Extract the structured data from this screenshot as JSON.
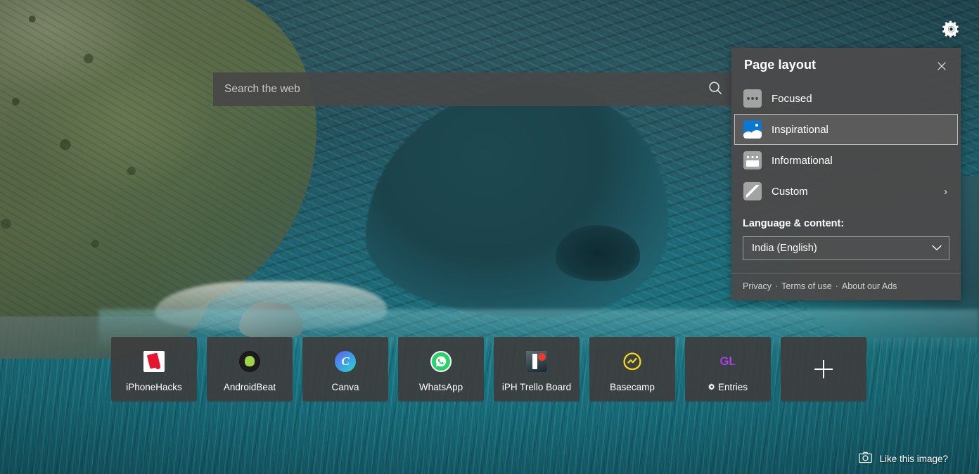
{
  "page": {
    "background_description": "Marble Caves turquoise rock formation over teal water",
    "settings_icon": "gear-icon"
  },
  "search": {
    "placeholder": "Search the web",
    "value": "",
    "submit_icon": "magnifier-icon"
  },
  "flyout": {
    "title": "Page layout",
    "close_label": "✕",
    "close_icon": "close-icon",
    "options": [
      {
        "label": "Focused",
        "icon": "focused-layout-icon",
        "selected": false,
        "has_chevron": false
      },
      {
        "label": "Inspirational",
        "icon": "inspirational-layout-icon",
        "selected": true,
        "has_chevron": false
      },
      {
        "label": "Informational",
        "icon": "informational-layout-icon",
        "selected": false,
        "has_chevron": false
      },
      {
        "label": "Custom",
        "icon": "pencil-layout-icon",
        "selected": false,
        "has_chevron": true
      }
    ],
    "chevron_glyph": "›",
    "language": {
      "label": "Language & content:",
      "value": "India (English)",
      "caret_glyph": "⌄",
      "options": [
        "India (English)"
      ]
    },
    "footer": {
      "privacy": "Privacy",
      "terms": "Terms of use",
      "ads": "About our Ads",
      "separator": "·"
    }
  },
  "tiles": [
    {
      "label": "iPhoneHacks",
      "icon": "iphonehacks-icon"
    },
    {
      "label": "AndroidBeat",
      "icon": "androidbeat-icon"
    },
    {
      "label": "Canva",
      "icon": "canva-icon",
      "glyph": "C"
    },
    {
      "label": "WhatsApp",
      "icon": "whatsapp-icon"
    },
    {
      "label": "iPH Trello Board",
      "icon": "trello-icon"
    },
    {
      "label": "Basecamp",
      "icon": "basecamp-icon"
    },
    {
      "label": "Entries",
      "icon": "entries-icon",
      "glyph": "GL",
      "prefix_icon": "gear-mini-icon"
    },
    {
      "label": "",
      "icon": "plus-icon",
      "is_add": true
    }
  ],
  "like_image": {
    "label": "Like this image?",
    "icon": "camera-icon"
  },
  "colors": {
    "panel_bg": "#4a4a4a",
    "panel_selected_bg": "#5b5b5b",
    "panel_selected_border": "#b9b9b9",
    "searchbar_bg": "#484848",
    "tile_bg": "#3d3d3d",
    "accent_blue": "#0a78d1",
    "water_teal": "#1c7d88",
    "text_primary": "#ffffff",
    "text_secondary": "#d0d0d0"
  }
}
